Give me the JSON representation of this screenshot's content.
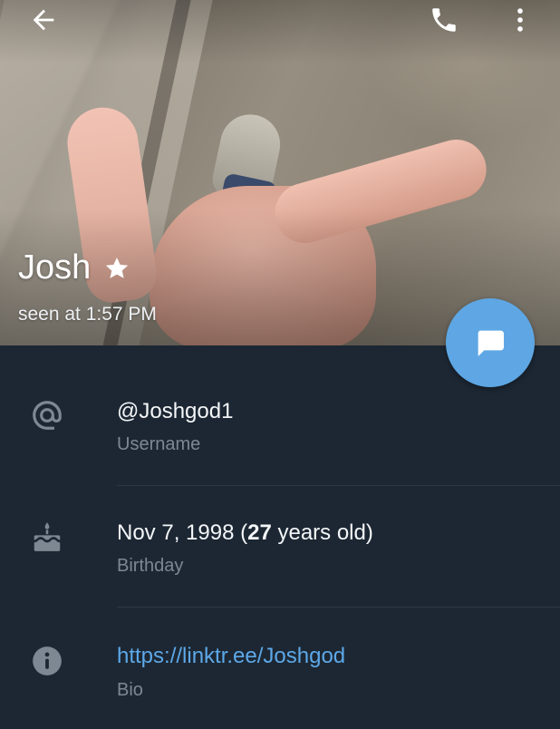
{
  "header": {
    "name": "Josh",
    "status": "seen at 1:57 PM",
    "icons": [
      "back-arrow-icon",
      "phone-icon",
      "more-vertical-icon",
      "star-icon",
      "message-icon"
    ]
  },
  "info": {
    "username": {
      "value": "@Joshgod1",
      "label": "Username",
      "icon": "at-sign-icon"
    },
    "birthday": {
      "date": "Nov 7, 1998 (",
      "age": "27",
      "age_suffix": " years old)",
      "label": "Birthday",
      "icon": "cake-icon"
    },
    "bio": {
      "value": "https://linktr.ee/Joshgod",
      "label": "Bio",
      "icon": "info-icon"
    }
  },
  "colors": {
    "background": "#1c2733",
    "accent": "#5ea7e4",
    "link": "#5da8e8",
    "secondary_text": "#7d8893",
    "divider": "#2c3844"
  }
}
